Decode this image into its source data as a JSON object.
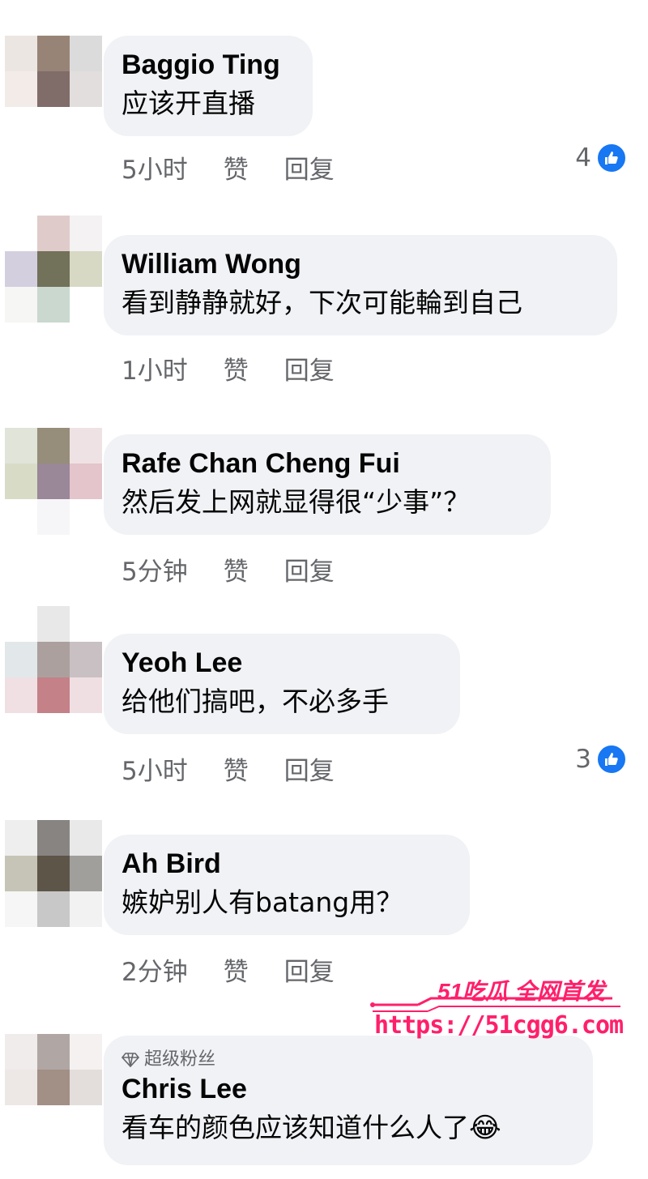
{
  "colors": {
    "bubble": "#f0f2f5",
    "meta": "#65676b",
    "like": "#1877f2",
    "watermark": "#ff1f6b"
  },
  "comments": [
    {
      "author": "Baggio Ting",
      "text": "应该开直播",
      "time": "5小时",
      "like_label": "赞",
      "reply_label": "回复",
      "reactions": "4"
    },
    {
      "author": "William Wong",
      "text": "看到静静就好，下次可能輪到自己",
      "time": "1小时",
      "like_label": "赞",
      "reply_label": "回复"
    },
    {
      "author": "Rafe Chan Cheng Fui",
      "text": "然后发上网就显得很“少事”？",
      "time": "5分钟",
      "like_label": "赞",
      "reply_label": "回复"
    },
    {
      "author": "Yeoh Lee",
      "text": "给他们搞吧，不必多手",
      "time": "5小时",
      "like_label": "赞",
      "reply_label": "回复",
      "reactions": "3"
    },
    {
      "author": "Ah Bird",
      "text": "嫉妒别人有batang用？",
      "time": "2分钟",
      "like_label": "赞",
      "reply_label": "回复"
    },
    {
      "author": "Chris Lee",
      "badge": "超级粉丝",
      "text": "看车的颜色应该知道什么人了",
      "emoji": "😂"
    }
  ],
  "watermark": {
    "title": "51吃瓜 全网首发",
    "url": "https://51cgg6.com"
  }
}
